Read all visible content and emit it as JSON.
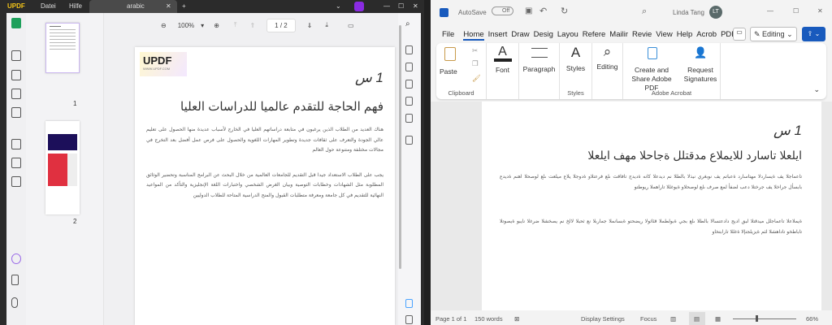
{
  "updf": {
    "logo": "UPDF",
    "menu": [
      "Datei",
      "Hilfe"
    ],
    "tab_label": "arabic",
    "zoom": "100%",
    "page_indicator": "1 / 2",
    "thumb_labels": [
      "1",
      "2"
    ],
    "page": {
      "logo_text": "UPDF",
      "logo_url": "WWW.UPDF.COM",
      "heading": "1 س",
      "title": "فهم الحاجة للتقدم عالميا للدراسات العليا",
      "para1": "هناك العديد من الطلاب الذين يرغبون في متابعة دراساتهم العليا في الخارج لأسباب عديدة منها الحصول على تعليم عالي الجودة والتعرف على ثقافات جديدة وتطوير المهارات اللغوية والحصول على فرص عمل أفضل بعد التخرج في مجالات مختلفة ومتنوعة حول العالم",
      "para2": "يجب على الطلاب الاستعداد جيدا قبل التقديم للجامعات العالمية من خلال البحث عن البرامج المناسبة وتحضير الوثائق المطلوبة مثل الشهادات وخطابات التوصية وبيان الغرض الشخصي واختبارات اللغة الإنجليزية والتأكد من المواعيد النهائية للتقديم في كل جامعة ومعرفة متطلبات القبول والمنح الدراسية المتاحة للطلاب الدوليين"
    }
  },
  "word": {
    "autosave": "AutoSave",
    "toggle": "Off",
    "user": "Linda Tang",
    "avatar": "LT",
    "tabs": [
      "File",
      "Home",
      "Insert",
      "Draw",
      "Desig",
      "Layou",
      "Refere",
      "Mailir",
      "Revie",
      "View",
      "Help",
      "Acrob",
      "PDFel"
    ],
    "editing_mode": "Editing",
    "ribbon": {
      "paste": "Paste",
      "clipboard": "Clipboard",
      "font": "Font",
      "paragraph": "Paragraph",
      "styles": "Styles",
      "styles_group": "Styles",
      "editing": "Editing",
      "create_share": "Create and Share Adobe PDF",
      "request": "Request Signatures",
      "acrobat_group": "Adobe Acrobat"
    },
    "doc": {
      "heading": "1 س",
      "title": "ايلعلا تاسارد للايملاع مدقتلل ةجاحلا مهف ايلعلا",
      "para1": "تاعماجلا يف ةيساردلا مهتاسارد ةعباتم يف نوبغري نيذلا بالطلا نم ديدعلا كانه ةديدج تافاقث ىلع فرعتلاو ةدوجلا يلاع ميلعت ىلع لوصحلا اهنم ةديدع بابسأل جراخلا يف جرختلا دعب لضفأ لمع صرف ىلع لوصحلاو ةيوغللا تاراهملا ريوطتو",
      "para2": "ةيملاعلا تاعماجلل ميدقتلا لبق اديج دادعتسالا بالطلا ىلع بجي ةبولطملا قئاثولا ريضحتو ةبسانملا جماربلا نع ثحبلا لالخ نم يصخشلا ضرغلا نايبو ةيصوتلا تاباطخو تاداهشلا لثم ةيزيلجنإلا ةغللا تارابتخاو"
    },
    "status": {
      "page": "Page 1 of 1",
      "words": "150 words",
      "display": "Display Settings",
      "focus": "Focus",
      "zoom": "66%"
    }
  }
}
